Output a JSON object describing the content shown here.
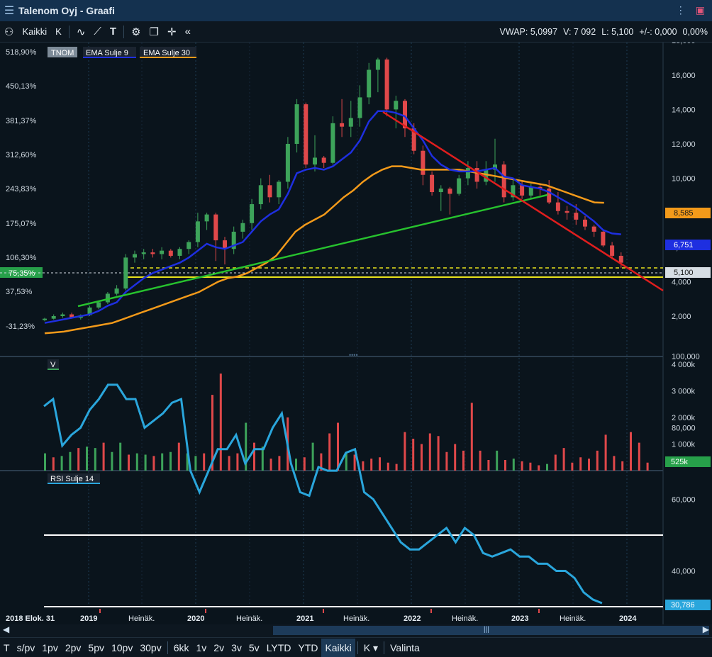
{
  "app": {
    "title": "Talenom Oyj - Graafi"
  },
  "toolbar": {
    "period_all": "Kaikki",
    "k_label": "K",
    "text_tool": "T",
    "collapse": "«"
  },
  "stats": {
    "vwap": "VWAP: 5,0997",
    "volume": "V: 7 092",
    "last": "L: 5,100",
    "change": "+/-: 0,000",
    "change_pct": "0,00%"
  },
  "legend": {
    "ticker": "TNOM",
    "ema9": "EMA Sulje 9",
    "ema30": "EMA Sulje 30",
    "volume_tag": "V",
    "rsi_tag": "RSI Sulje 14"
  },
  "colors": {
    "ema9": "#1e2fe0",
    "ema30": "#f39a1a",
    "up": "#3da35a",
    "down": "#e0484a",
    "rsi": "#2aa6dc",
    "green_trend": "#27c22e",
    "red_trend": "#e01e1e",
    "support": "#e8e21c"
  },
  "price_axis": {
    "labels": [
      "18,000",
      "16,000",
      "14,000",
      "12,000",
      "10,000",
      "8,000",
      "6,000",
      "4,000",
      "2,000"
    ],
    "values": [
      18,
      16,
      14,
      12,
      10,
      8,
      6,
      4,
      2
    ],
    "tag_ema30": "8,585",
    "tag_ema9": "6,751",
    "tag_last": "5,100"
  },
  "pct_axis": {
    "labels": [
      "518,90%",
      "450,13%",
      "381,37%",
      "312,60%",
      "243,83%",
      "175,07%",
      "106,30%",
      "37,53%",
      "-31,23%"
    ],
    "current": "75,35%"
  },
  "volume_axis": {
    "labels": [
      "4 000k",
      "3 000k",
      "2 000k",
      "1 000k"
    ],
    "values": [
      4000,
      3000,
      2000,
      1000
    ],
    "tag_last": "525k"
  },
  "rsi_axis": {
    "labels": [
      "100,000",
      "80,000",
      "60,000",
      "40,000"
    ],
    "values": [
      100,
      80,
      60,
      40
    ],
    "tag_last": "30,786"
  },
  "time_axis": {
    "labels": [
      "2018 Elok. 31",
      "2019",
      "Heinäk.",
      "2020",
      "Heinäk.",
      "2021",
      "Heinäk.",
      "2022",
      "Heinäk.",
      "2023",
      "Heinäk.",
      "2024"
    ]
  },
  "bottom": {
    "items": [
      "T",
      "s/pv",
      "1pv",
      "2pv",
      "5pv",
      "10pv",
      "30pv",
      "6kk",
      "1v",
      "2v",
      "3v",
      "5v",
      "LYTD",
      "YTD",
      "Kaikki",
      "K ▾",
      "Valinta"
    ],
    "active": "Kaikki"
  },
  "chart_data": {
    "type": "candlestick",
    "interval": "monthly",
    "start": "2018-08",
    "candles": [
      [
        1.8,
        1.9,
        1.7,
        1.85
      ],
      [
        1.85,
        2.1,
        1.8,
        2.0
      ],
      [
        2.0,
        2.2,
        1.9,
        2.1
      ],
      [
        2.1,
        2.2,
        1.85,
        1.9
      ],
      [
        1.9,
        2.1,
        1.8,
        2.05
      ],
      [
        2.05,
        2.6,
        2.0,
        2.5
      ],
      [
        2.5,
        2.9,
        2.4,
        2.8
      ],
      [
        2.8,
        3.4,
        2.7,
        3.3
      ],
      [
        3.3,
        3.8,
        3.2,
        3.6
      ],
      [
        3.6,
        5.6,
        3.5,
        5.4
      ],
      [
        5.4,
        5.8,
        5.1,
        5.6
      ],
      [
        5.6,
        5.9,
        5.3,
        5.7
      ],
      [
        5.7,
        5.9,
        5.4,
        5.6
      ],
      [
        5.6,
        6.0,
        5.3,
        5.8
      ],
      [
        5.8,
        5.9,
        5.4,
        5.5
      ],
      [
        5.5,
        6.0,
        5.3,
        5.9
      ],
      [
        5.9,
        6.4,
        5.6,
        6.3
      ],
      [
        6.3,
        8.0,
        6.0,
        7.5
      ],
      [
        7.5,
        8.0,
        7.0,
        7.9
      ],
      [
        7.9,
        8.0,
        5.2,
        6.4
      ],
      [
        6.4,
        6.6,
        5.0,
        5.9
      ],
      [
        5.9,
        7.2,
        5.6,
        6.9
      ],
      [
        6.9,
        7.6,
        6.5,
        7.4
      ],
      [
        7.4,
        8.8,
        7.0,
        8.5
      ],
      [
        8.5,
        10.0,
        8.2,
        9.6
      ],
      [
        9.6,
        10.2,
        8.6,
        8.9
      ],
      [
        8.9,
        9.9,
        8.5,
        9.8
      ],
      [
        9.8,
        12.4,
        9.4,
        12.0
      ],
      [
        12.0,
        14.6,
        11.5,
        14.3
      ],
      [
        14.3,
        14.4,
        10.6,
        10.8
      ],
      [
        10.8,
        12.5,
        10.4,
        11.2
      ],
      [
        11.2,
        11.3,
        10.6,
        10.9
      ],
      [
        10.9,
        13.6,
        10.8,
        13.2
      ],
      [
        13.2,
        14.6,
        12.4,
        13.0
      ],
      [
        13.0,
        14.5,
        12.4,
        13.5
      ],
      [
        13.5,
        15.4,
        13.0,
        14.7
      ],
      [
        14.7,
        16.7,
        14.3,
        16.3
      ],
      [
        16.3,
        17.0,
        15.0,
        16.9
      ],
      [
        16.9,
        17.0,
        13.6,
        14.0
      ],
      [
        14.0,
        14.8,
        12.9,
        14.5
      ],
      [
        14.5,
        14.6,
        12.4,
        12.9
      ],
      [
        12.9,
        13.2,
        11.4,
        11.6
      ],
      [
        11.6,
        11.9,
        9.6,
        10.2
      ],
      [
        10.2,
        10.4,
        9.0,
        9.2
      ],
      [
        9.2,
        9.6,
        8.1,
        9.4
      ],
      [
        9.4,
        9.5,
        7.9,
        9.1
      ],
      [
        9.1,
        10.2,
        9.0,
        10.0
      ],
      [
        10.0,
        11.0,
        9.6,
        10.6
      ],
      [
        10.6,
        11.0,
        9.4,
        9.8
      ],
      [
        9.8,
        11.0,
        9.6,
        10.5
      ],
      [
        10.5,
        12.3,
        9.8,
        10.8
      ],
      [
        10.8,
        11.0,
        8.6,
        8.9
      ],
      [
        8.9,
        9.9,
        8.7,
        9.6
      ],
      [
        9.6,
        9.8,
        8.8,
        9.0
      ],
      [
        9.0,
        9.7,
        8.8,
        9.5
      ],
      [
        9.5,
        9.7,
        9.0,
        9.4
      ],
      [
        9.4,
        9.9,
        8.5,
        8.6
      ],
      [
        8.6,
        9.2,
        7.9,
        8.1
      ],
      [
        8.1,
        8.4,
        7.6,
        8.0
      ],
      [
        8.0,
        8.5,
        7.3,
        7.6
      ],
      [
        7.6,
        7.8,
        7.0,
        7.2
      ],
      [
        7.2,
        7.3,
        6.6,
        6.9
      ],
      [
        6.9,
        7.0,
        6.0,
        6.1
      ],
      [
        6.1,
        6.3,
        5.3,
        5.5
      ],
      [
        5.5,
        5.7,
        4.8,
        5.1
      ]
    ],
    "ema9": [
      1.6,
      1.7,
      1.8,
      1.9,
      2.0,
      2.1,
      2.3,
      2.6,
      2.8,
      3.4,
      3.8,
      4.2,
      4.5,
      4.7,
      4.9,
      5.1,
      5.4,
      5.8,
      6.2,
      6.0,
      5.9,
      6.1,
      6.3,
      6.9,
      7.5,
      7.9,
      8.2,
      9.1,
      10.3,
      10.5,
      10.6,
      10.5,
      10.7,
      11.1,
      11.5,
      12.2,
      13.3,
      13.9,
      13.9,
      13.8,
      13.6,
      12.9,
      12.2,
      11.3,
      10.8,
      10.5,
      10.4,
      10.4,
      10.4,
      10.5,
      10.6,
      10.1,
      10.0,
      9.6,
      9.5,
      9.4,
      9.2,
      8.9,
      8.6,
      8.3,
      7.9,
      7.5,
      7.0,
      6.8,
      6.75
    ],
    "ema30": [
      1.0,
      1.05,
      1.1,
      1.2,
      1.3,
      1.4,
      1.5,
      1.6,
      1.8,
      2.0,
      2.2,
      2.4,
      2.6,
      2.8,
      3.0,
      3.2,
      3.4,
      3.7,
      4.0,
      4.2,
      4.3,
      4.5,
      4.8,
      5.1,
      5.5,
      6.2,
      6.9,
      7.3,
      7.6,
      7.9,
      8.4,
      8.9,
      9.3,
      9.8,
      10.2,
      10.5,
      10.7,
      10.7,
      10.6,
      10.5,
      10.5,
      10.5,
      10.5,
      10.5,
      10.4,
      10.3,
      10.2,
      10.1,
      10.0,
      9.9,
      9.8,
      9.7,
      9.6,
      9.4,
      9.2,
      9.0,
      8.8,
      8.6,
      8.58
    ],
    "volume_k": [
      650,
      500,
      550,
      700,
      850,
      900,
      850,
      1050,
      700,
      1050,
      600,
      650,
      600,
      550,
      650,
      700,
      1050,
      650,
      550,
      650,
      2850,
      3650,
      550,
      650,
      1800,
      1050,
      900,
      450,
      550,
      2000,
      450,
      500,
      1050,
      650,
      1400,
      1800,
      700,
      600,
      350,
      450,
      500,
      300,
      250,
      1450,
      1200,
      1000,
      1400,
      1300,
      700,
      1000,
      750,
      2550,
      750,
      400,
      750,
      400,
      450,
      350,
      300,
      200,
      250,
      600,
      850,
      300,
      500,
      450,
      750,
      1350,
      550,
      350,
      1450,
      1050,
      300
    ]
  }
}
